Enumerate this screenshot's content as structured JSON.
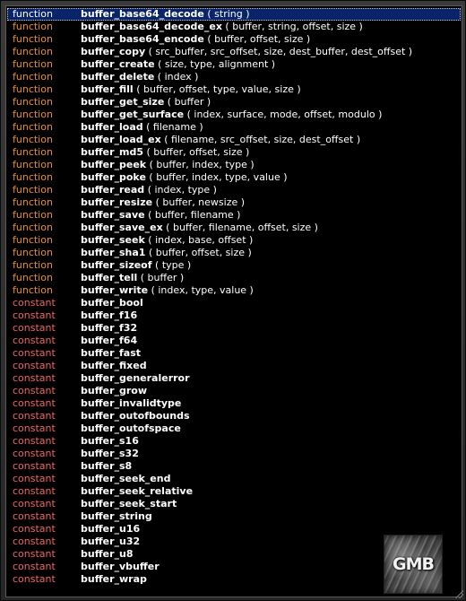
{
  "items": [
    {
      "kind": "function",
      "name": "buffer_base64_decode",
      "args": "( string )",
      "selected": true
    },
    {
      "kind": "function",
      "name": "buffer_base64_decode_ex",
      "args": "( buffer, string, offset, size )"
    },
    {
      "kind": "function",
      "name": "buffer_base64_encode",
      "args": "( buffer, offset, size )"
    },
    {
      "kind": "function",
      "name": "buffer_copy",
      "args": "( src_buffer, src_offset, size, dest_buffer, dest_offset )"
    },
    {
      "kind": "function",
      "name": "buffer_create",
      "args": "( size, type, alignment )"
    },
    {
      "kind": "function",
      "name": "buffer_delete",
      "args": "( index )"
    },
    {
      "kind": "function",
      "name": "buffer_fill",
      "args": "( buffer, offset, type, value, size )"
    },
    {
      "kind": "function",
      "name": "buffer_get_size",
      "args": "( buffer )"
    },
    {
      "kind": "function",
      "name": "buffer_get_surface",
      "args": "( index, surface, mode, offset, modulo )"
    },
    {
      "kind": "function",
      "name": "buffer_load",
      "args": "( filename )"
    },
    {
      "kind": "function",
      "name": "buffer_load_ex",
      "args": "( filename, src_offset, size, dest_offset )"
    },
    {
      "kind": "function",
      "name": "buffer_md5",
      "args": "( buffer, offset, size )"
    },
    {
      "kind": "function",
      "name": "buffer_peek",
      "args": "( buffer, index, type )"
    },
    {
      "kind": "function",
      "name": "buffer_poke",
      "args": "( buffer, index, type, value )"
    },
    {
      "kind": "function",
      "name": "buffer_read",
      "args": "( index, type )"
    },
    {
      "kind": "function",
      "name": "buffer_resize",
      "args": "( buffer, newsize )"
    },
    {
      "kind": "function",
      "name": "buffer_save",
      "args": "( buffer, filename )"
    },
    {
      "kind": "function",
      "name": "buffer_save_ex",
      "args": "( buffer, filename, offset, size )"
    },
    {
      "kind": "function",
      "name": "buffer_seek",
      "args": "( index, base, offset )"
    },
    {
      "kind": "function",
      "name": "buffer_sha1",
      "args": "( buffer, offset, size )"
    },
    {
      "kind": "function",
      "name": "buffer_sizeof",
      "args": "( type )"
    },
    {
      "kind": "function",
      "name": "buffer_tell",
      "args": "( buffer )"
    },
    {
      "kind": "function",
      "name": "buffer_write",
      "args": "( index, type, value )"
    },
    {
      "kind": "constant",
      "name": "buffer_bool",
      "args": ""
    },
    {
      "kind": "constant",
      "name": "buffer_f16",
      "args": ""
    },
    {
      "kind": "constant",
      "name": "buffer_f32",
      "args": ""
    },
    {
      "kind": "constant",
      "name": "buffer_f64",
      "args": ""
    },
    {
      "kind": "constant",
      "name": "buffer_fast",
      "args": ""
    },
    {
      "kind": "constant",
      "name": "buffer_fixed",
      "args": ""
    },
    {
      "kind": "constant",
      "name": "buffer_generalerror",
      "args": ""
    },
    {
      "kind": "constant",
      "name": "buffer_grow",
      "args": ""
    },
    {
      "kind": "constant",
      "name": "buffer_invalidtype",
      "args": ""
    },
    {
      "kind": "constant",
      "name": "buffer_outofbounds",
      "args": ""
    },
    {
      "kind": "constant",
      "name": "buffer_outofspace",
      "args": ""
    },
    {
      "kind": "constant",
      "name": "buffer_s16",
      "args": ""
    },
    {
      "kind": "constant",
      "name": "buffer_s32",
      "args": ""
    },
    {
      "kind": "constant",
      "name": "buffer_s8",
      "args": ""
    },
    {
      "kind": "constant",
      "name": "buffer_seek_end",
      "args": ""
    },
    {
      "kind": "constant",
      "name": "buffer_seek_relative",
      "args": ""
    },
    {
      "kind": "constant",
      "name": "buffer_seek_start",
      "args": ""
    },
    {
      "kind": "constant",
      "name": "buffer_string",
      "args": ""
    },
    {
      "kind": "constant",
      "name": "buffer_u16",
      "args": ""
    },
    {
      "kind": "constant",
      "name": "buffer_u32",
      "args": ""
    },
    {
      "kind": "constant",
      "name": "buffer_u8",
      "args": ""
    },
    {
      "kind": "constant",
      "name": "buffer_vbuffer",
      "args": ""
    },
    {
      "kind": "constant",
      "name": "buffer_wrap",
      "args": ""
    }
  ],
  "logo": {
    "text": "GMB"
  },
  "colors": {
    "function": "#e8902a",
    "constant": "#f26363",
    "selection": "#0a246a"
  }
}
